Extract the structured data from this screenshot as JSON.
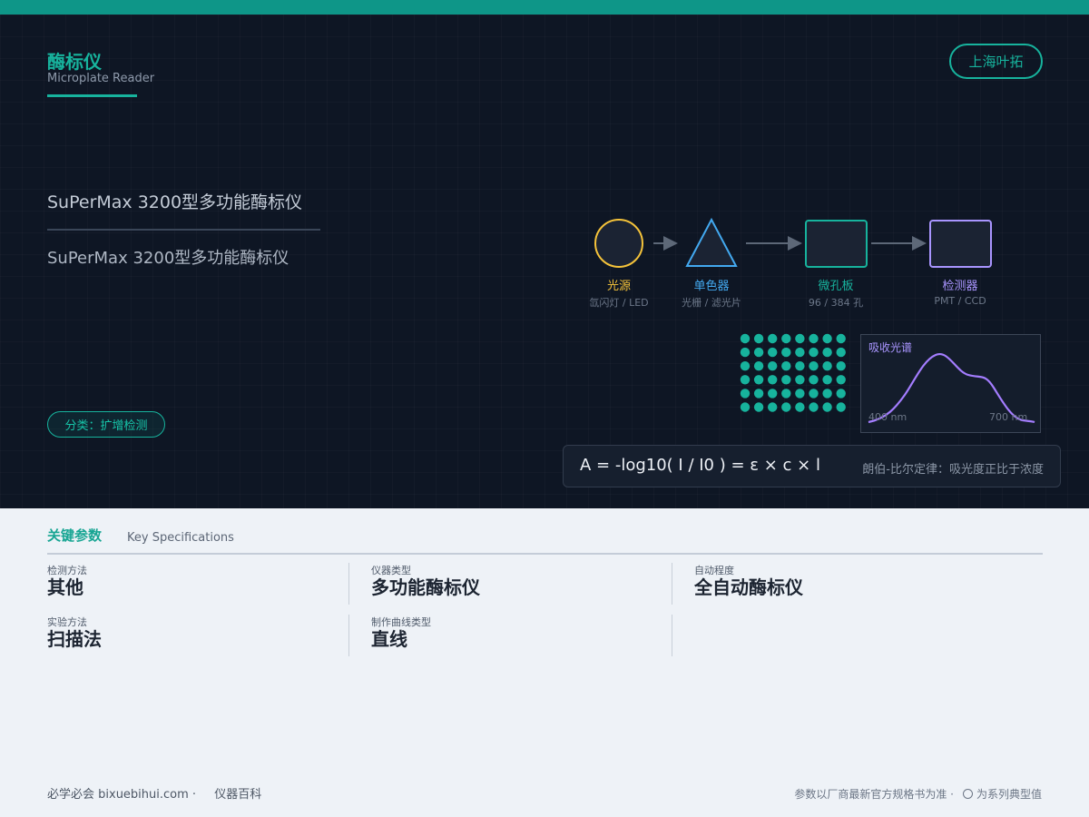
{
  "header": {
    "title": "酶标仪",
    "subtitle": "Microplate Reader",
    "manufacturer": "上海叶拓"
  },
  "product": {
    "model_name": "SuPerMax 3200型多功能酶标仪",
    "model_name_repeat": "SuPerMax 3200型多功能酶标仪",
    "category": "分类：扩增检测"
  },
  "optical_path": [
    {
      "label": "光源",
      "sub": "氙闪灯 / LED",
      "color": "#f5c33a",
      "icon": "lamp-circle"
    },
    {
      "label": "单色器",
      "sub": "光栅 / 滤光片",
      "color": "#43a9f0",
      "icon": "prism-triangle"
    },
    {
      "label": "微孔板",
      "sub": "96 / 384 孔",
      "color": "#17b39d",
      "icon": "plate-square"
    },
    {
      "label": "检测器",
      "sub": "PMT / CCD",
      "color": "#a995ff",
      "icon": "detector-square"
    }
  ],
  "plate": {
    "rows": 6,
    "cols": 8,
    "well_color": "#17b39d"
  },
  "spectrum": {
    "title": "吸收光谱",
    "x_start": "400 nm",
    "x_end": "700 nm",
    "line_color": "#a47dff"
  },
  "formula": {
    "expression": "A = -log10( I / I0 ) = ε × c × l",
    "note": "朗伯-比尔定律：吸光度正比于浓度"
  },
  "specs": {
    "title": "关键参数",
    "subtitle": "Key Specifications",
    "items": [
      {
        "label": "检测方法",
        "value": "其他"
      },
      {
        "label": "仪器类型",
        "value": "多功能酶标仪"
      },
      {
        "label": "自动程度",
        "value": "全自动酶标仪"
      },
      {
        "label": "实验方法",
        "value": "扫描法"
      },
      {
        "label": "制作曲线类型",
        "value": "直线"
      }
    ]
  },
  "footer": {
    "site": "必学必会 bixuebihui.com ·",
    "section": "仪器百科",
    "disclaimer": "参数以厂商最新官方规格书为准 ·",
    "note": "为系列典型值"
  },
  "colors": {
    "accent": "#0e9688",
    "hero_bg": "#0e1624",
    "page_bg": "#eef2f7"
  }
}
